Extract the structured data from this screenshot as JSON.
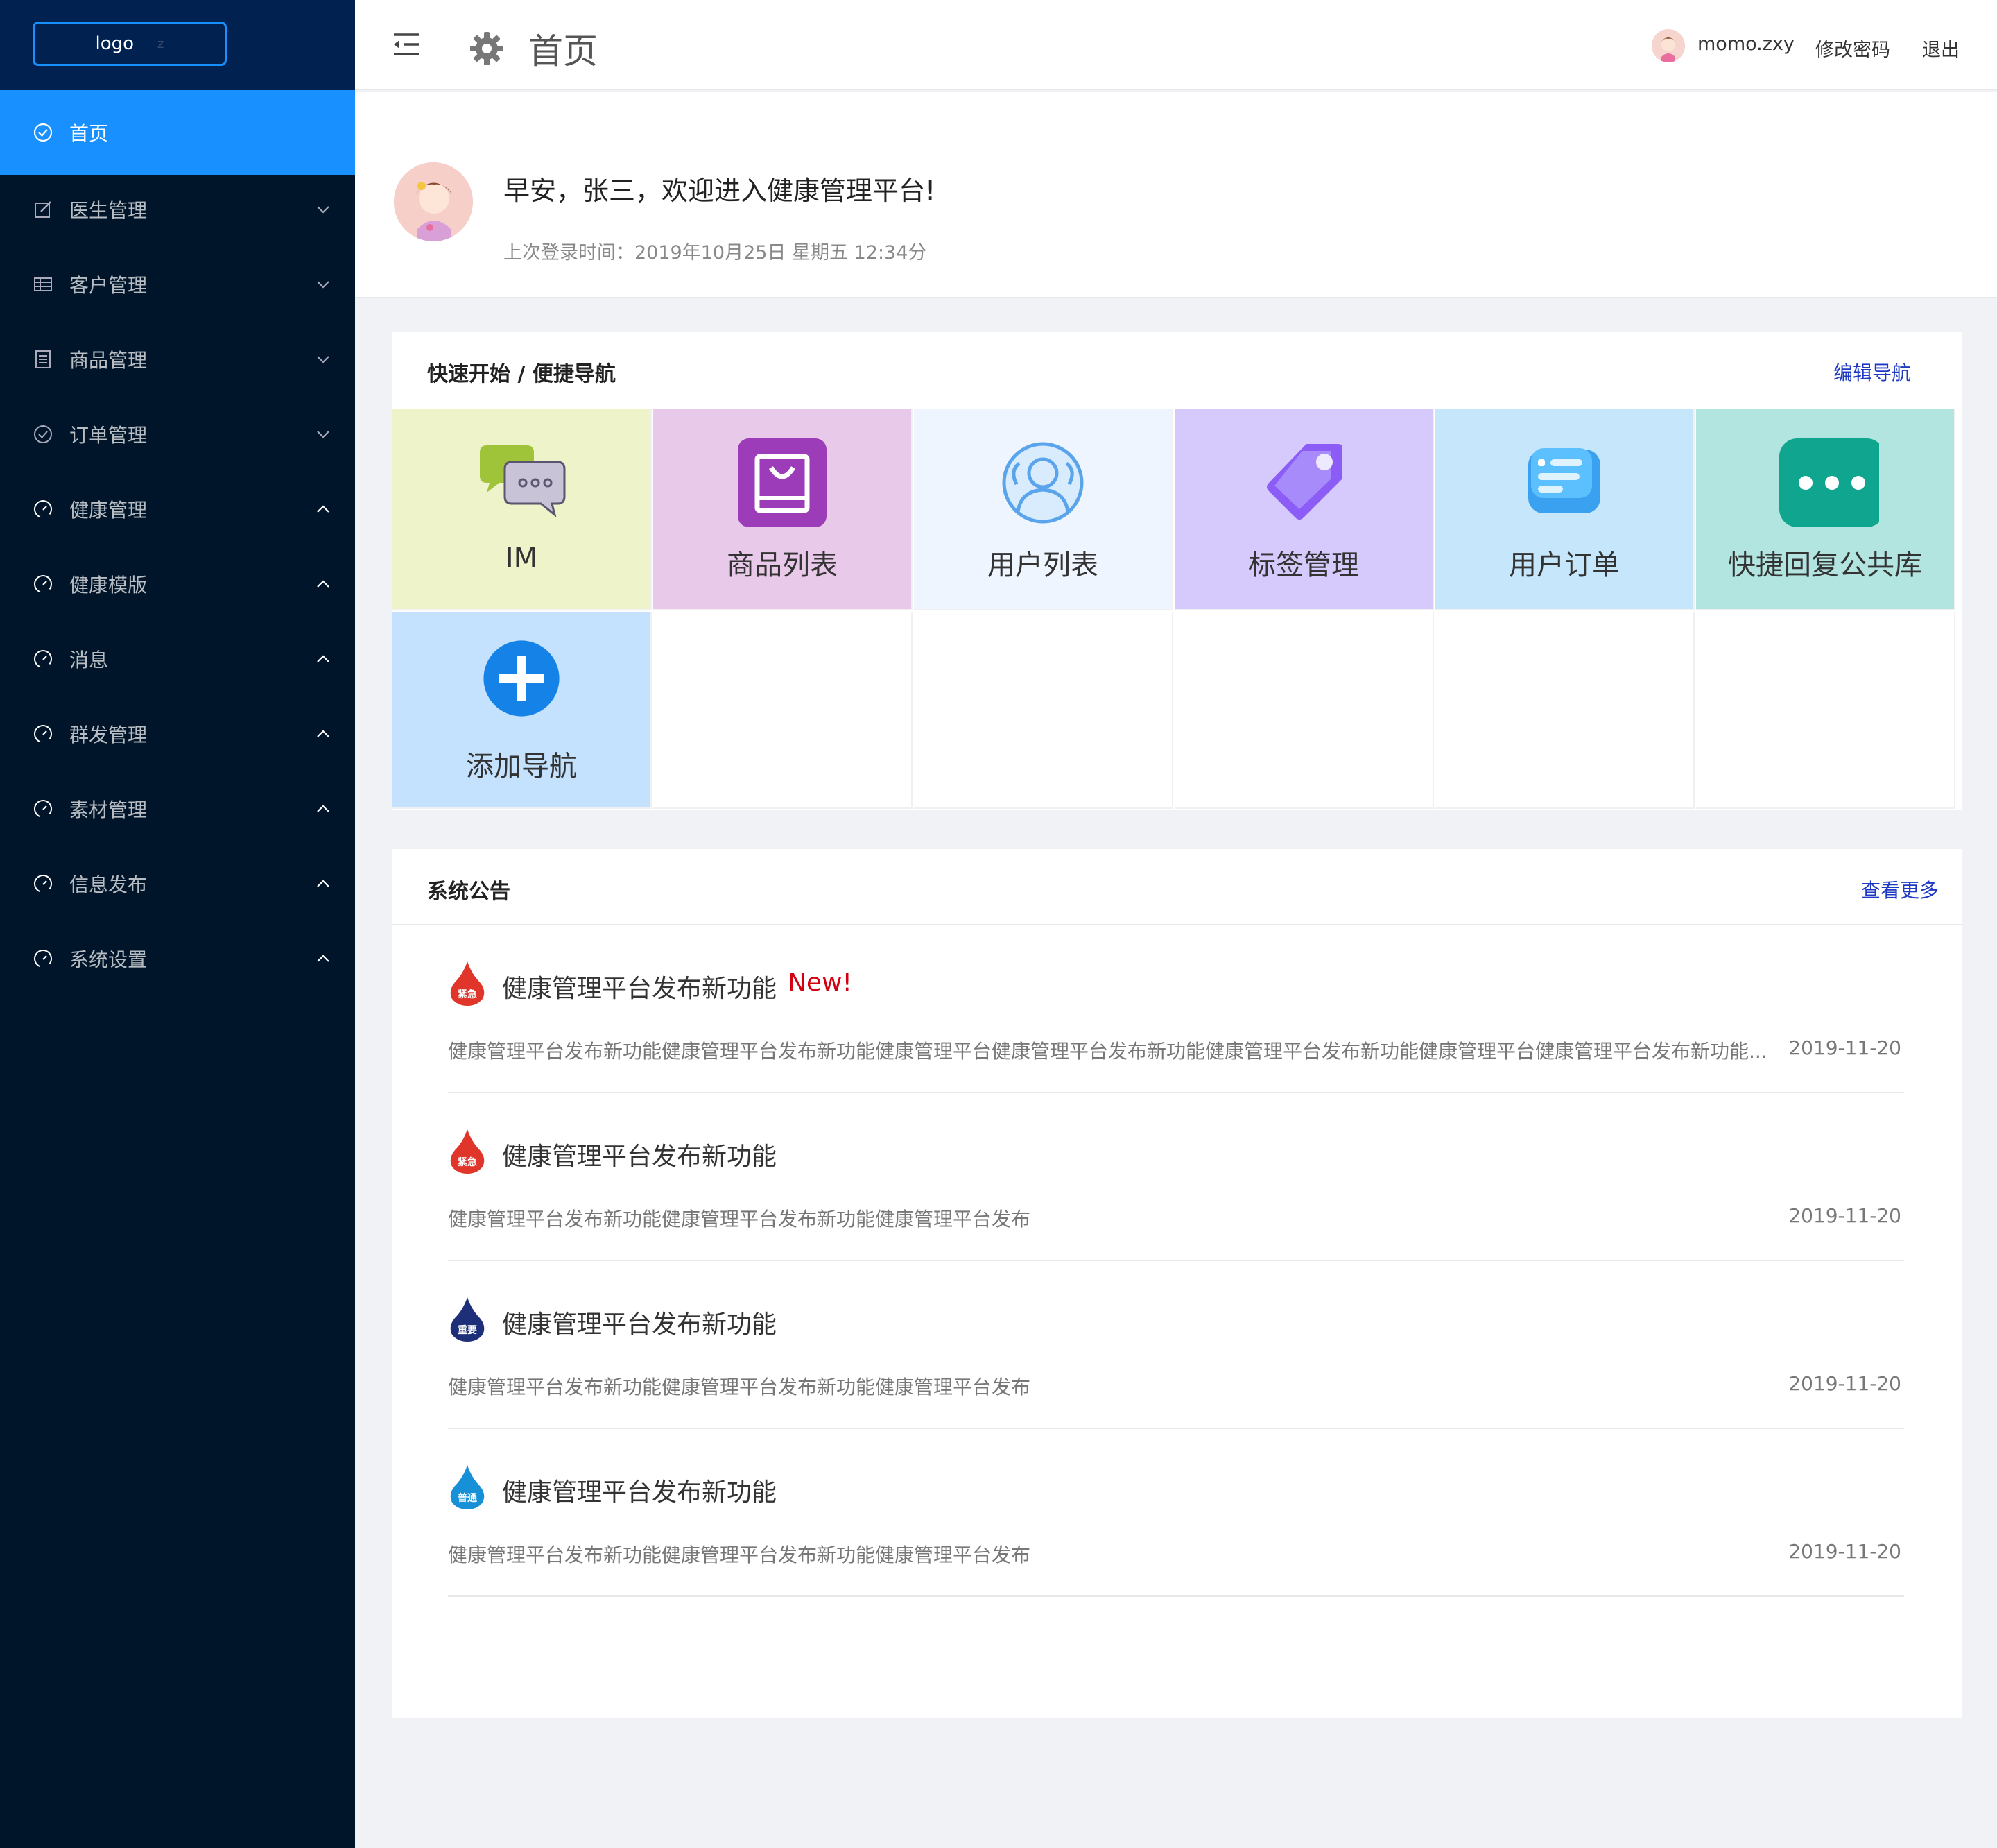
{
  "sidebar": {
    "logo": "logo",
    "logo_suffix": "z",
    "items": [
      {
        "label": "首页",
        "icon": "check-circle-icon",
        "active": true
      },
      {
        "label": "医生管理",
        "icon": "edit-icon",
        "arrow": "down"
      },
      {
        "label": "客户管理",
        "icon": "table-icon",
        "arrow": "down"
      },
      {
        "label": "商品管理",
        "icon": "list-icon",
        "arrow": "down"
      },
      {
        "label": "订单管理",
        "icon": "check-circle-icon",
        "arrow": "down"
      },
      {
        "label": "健康管理",
        "icon": "dashboard-icon",
        "arrow": "up"
      },
      {
        "label": "健康模版",
        "icon": "dashboard-icon",
        "arrow": "up"
      },
      {
        "label": "消息",
        "icon": "dashboard-icon",
        "arrow": "up"
      },
      {
        "label": "群发管理",
        "icon": "dashboard-icon",
        "arrow": "up"
      },
      {
        "label": "素材管理",
        "icon": "dashboard-icon",
        "arrow": "up"
      },
      {
        "label": "信息发布",
        "icon": "dashboard-icon",
        "arrow": "up"
      },
      {
        "label": "系统设置",
        "icon": "dashboard-icon",
        "arrow": "up"
      }
    ]
  },
  "header": {
    "title": "首页",
    "username": "momo.zxy",
    "change_password": "修改密码",
    "logout": "退出"
  },
  "welcome": {
    "greeting": "早安，张三，欢迎进入健康管理平台!",
    "last_login": "上次登录时间：2019年10月25日 星期五 12:34分"
  },
  "quick_nav": {
    "title": "快速开始 / 便捷导航",
    "edit_label": "编辑导航",
    "tiles": [
      {
        "label": "IM",
        "icon": "chat-bubbles-icon",
        "bg": "#eef3c9"
      },
      {
        "label": "商品列表",
        "icon": "shopping-bag-icon",
        "bg": "#e8c9ea"
      },
      {
        "label": "用户列表",
        "icon": "users-icon",
        "bg": "#eef5ff"
      },
      {
        "label": "标签管理",
        "icon": "tag-icon",
        "bg": "#d6c9fb"
      },
      {
        "label": "用户订单",
        "icon": "order-icon",
        "bg": "#c6e7fb"
      },
      {
        "label": "快捷回复公共库",
        "icon": "quick-reply-icon",
        "bg": "#b2e4e0"
      },
      {
        "label": "添加导航",
        "icon": "add-circle-icon",
        "bg": "#c4e1fd"
      }
    ]
  },
  "notices": {
    "title": "系统公告",
    "more_label": "查看更多",
    "new_tag": "New!",
    "items": [
      {
        "badge": "紧急",
        "badge_color": "#e0352b",
        "title": "健康管理平台发布新功能",
        "is_new": true,
        "desc": "健康管理平台发布新功能健康管理平台发布新功能健康管理平台健康管理平台发布新功能健康管理平台发布新功能健康管理平台健康管理平台发布新功能...",
        "date": "2019-11-20"
      },
      {
        "badge": "紧急",
        "badge_color": "#e0352b",
        "title": "健康管理平台发布新功能",
        "is_new": false,
        "desc": "健康管理平台发布新功能健康管理平台发布新功能健康管理平台发布",
        "date": "2019-11-20"
      },
      {
        "badge": "重要",
        "badge_color": "#1e2f7a",
        "title": "健康管理平台发布新功能",
        "is_new": false,
        "desc": "健康管理平台发布新功能健康管理平台发布新功能健康管理平台发布",
        "date": "2019-11-20"
      },
      {
        "badge": "普通",
        "badge_color": "#1890d8",
        "title": "健康管理平台发布新功能",
        "is_new": false,
        "desc": "健康管理平台发布新功能健康管理平台发布新功能健康管理平台发布",
        "date": "2019-11-20"
      }
    ]
  },
  "colors": {
    "sidebar_bg": "#001529",
    "accent": "#1890ff",
    "link": "#1d39c4",
    "new_red": "#d4000f"
  }
}
